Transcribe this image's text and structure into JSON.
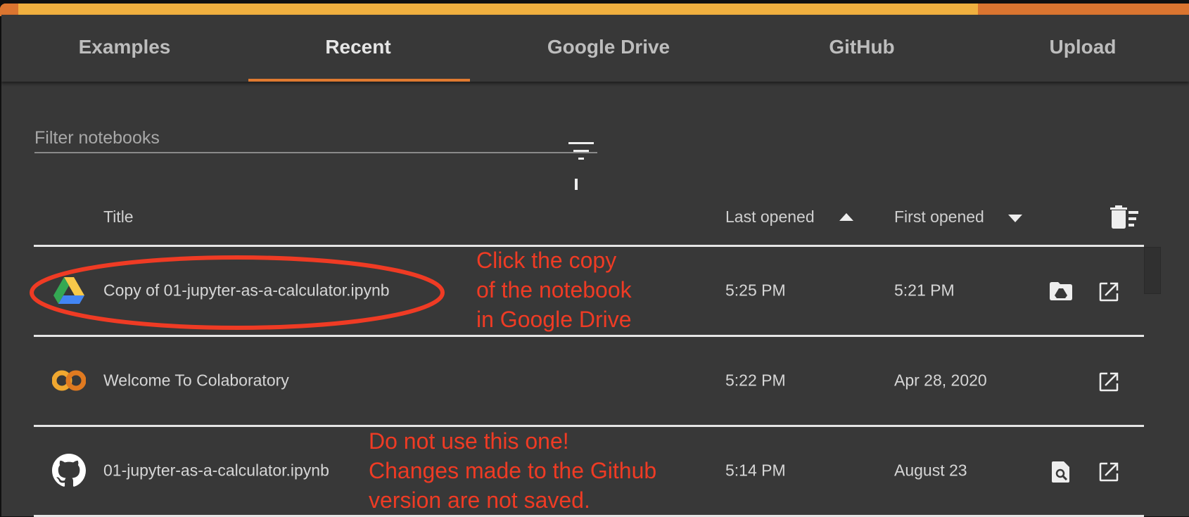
{
  "tabs": [
    {
      "label": "Examples"
    },
    {
      "label": "Recent",
      "active": true
    },
    {
      "label": "Google Drive"
    },
    {
      "label": "GitHub"
    },
    {
      "label": "Upload"
    }
  ],
  "filter": {
    "placeholder": "Filter notebooks",
    "value": ""
  },
  "columns": {
    "title": "Title",
    "last_opened": "Last opened",
    "first_opened": "First opened"
  },
  "rows": [
    {
      "title": "Copy of 01-jupyter-as-a-calculator.ipynb",
      "source_icon": "google-drive-icon",
      "last_opened": "5:25 PM",
      "first_opened": "5:21 PM"
    },
    {
      "title": "Welcome To Colaboratory",
      "source_icon": "colab-icon",
      "last_opened": "5:22 PM",
      "first_opened": "Apr 28, 2020"
    },
    {
      "title": "01-jupyter-as-a-calculator.ipynb",
      "source_icon": "github-icon",
      "last_opened": "5:14 PM",
      "first_opened": "August 23"
    }
  ],
  "annotations": {
    "drive": [
      "Click the copy",
      "of the notebook",
      "in Google Drive"
    ],
    "github": [
      "Do not use this one!",
      "Changes made to the Github",
      "version are not saved."
    ]
  },
  "colors": {
    "accent": "#e07a30",
    "annotation": "#ef3b24",
    "background": "#383838"
  }
}
